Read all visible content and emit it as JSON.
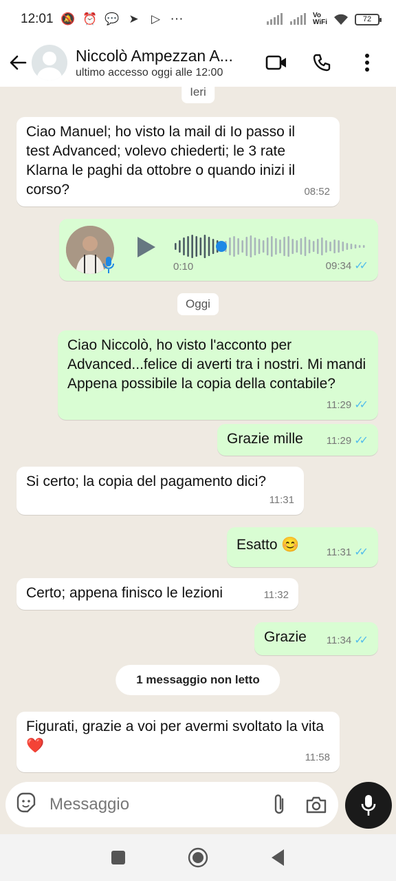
{
  "status_bar": {
    "time": "12:01",
    "dots": "···",
    "vowifi_top": "Vo",
    "vowifi_bottom": "WiFi",
    "battery": "72"
  },
  "header": {
    "contact_name": "Niccolò Ampezzan A...",
    "contact_status": "ultimo accesso oggi alle 12:00"
  },
  "chat": {
    "date_yesterday": "Ieri",
    "date_today": "Oggi",
    "unread_label": "1 messaggio non letto",
    "messages": [
      {
        "direction": "in",
        "text": "Ciao Manuel; ho visto la mail di Io passo il test Advanced; volevo chiederti; le 3 rate Klarna le paghi da ottobre o quando inizi il corso?",
        "time": "08:52"
      },
      {
        "direction": "out",
        "type": "voice",
        "duration": "0:10",
        "time": "09:34",
        "progress": 0.25
      },
      {
        "direction": "out",
        "text": "Ciao Niccolò, ho visto l'acconto per Advanced...felice di averti tra i nostri. Mi mandi Appena possibile la copia della contabile?",
        "time": "11:29"
      },
      {
        "direction": "out",
        "text": "Grazie mille",
        "time": "11:29"
      },
      {
        "direction": "in",
        "text": "Si certo; la copia del pagamento dici?",
        "time": "11:31"
      },
      {
        "direction": "out",
        "text": "Esatto 😊",
        "time": "11:31"
      },
      {
        "direction": "in",
        "text": "Certo; appena finisco le lezioni",
        "time": "11:32"
      },
      {
        "direction": "out",
        "text": "Grazie",
        "time": "11:34"
      },
      {
        "direction": "in",
        "text": "Figurati, grazie a voi per avermi svoltato la vita❤️",
        "time": "11:58"
      }
    ]
  },
  "input": {
    "placeholder": "Messaggio"
  },
  "colors": {
    "incoming": "#ffffff",
    "outgoing": "#d9fdd3",
    "read_ticks": "#53bdeb",
    "background": "#efeae2"
  }
}
